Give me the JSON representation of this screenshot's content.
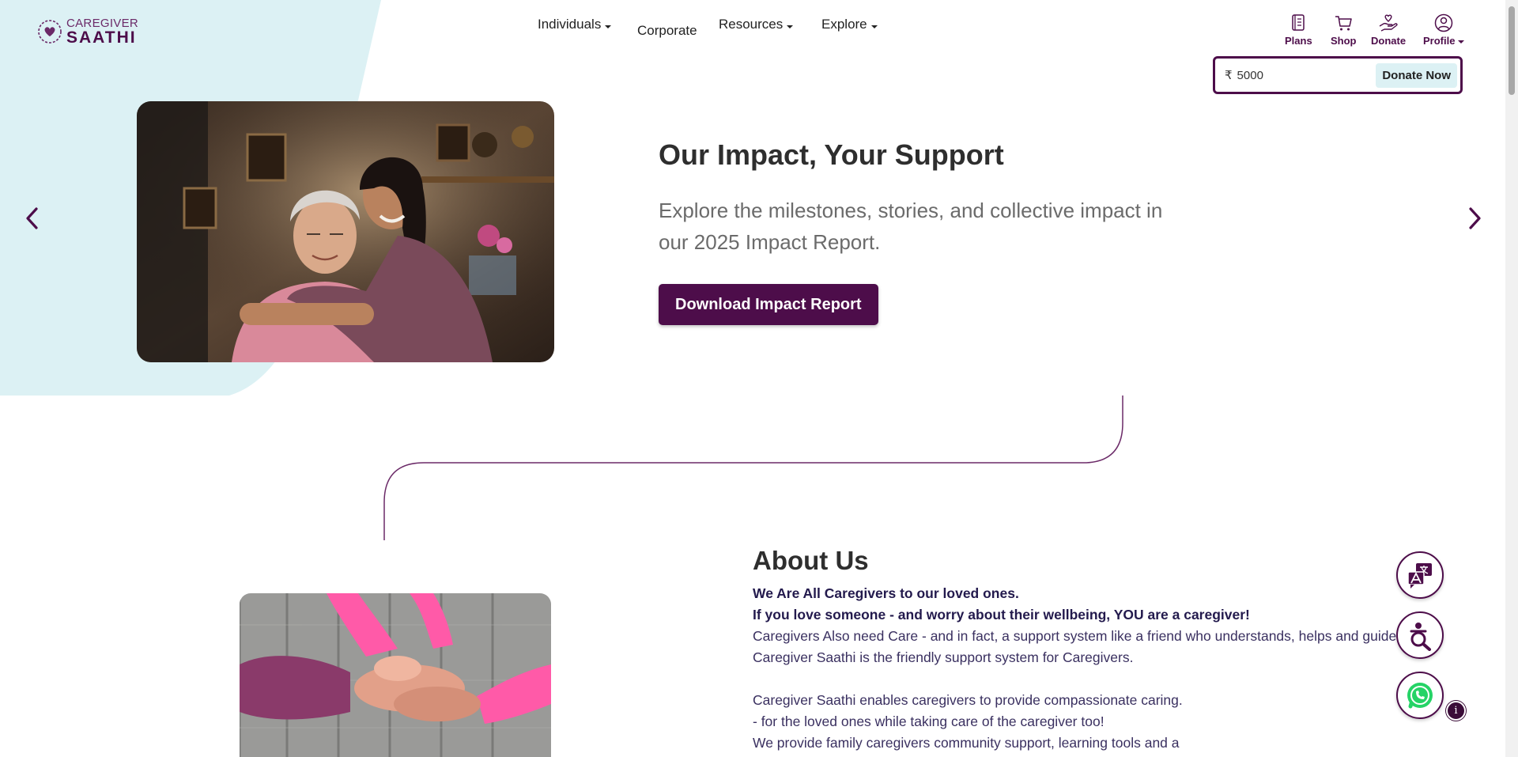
{
  "header": {
    "logo": {
      "line1": "CAREGIVER",
      "line2": "SAATHI"
    },
    "nav": [
      {
        "label": "Individuals",
        "dropdown": true
      },
      {
        "label": "Corporate",
        "dropdown": false
      },
      {
        "label": "Resources",
        "dropdown": true
      },
      {
        "label": "Explore",
        "dropdown": true
      }
    ],
    "icons": {
      "plans": "Plans",
      "shop": "Shop",
      "donate": "Donate",
      "profile": "Profile"
    },
    "donation": {
      "currency": "₹",
      "amount": "5000",
      "button": "Donate Now"
    }
  },
  "hero": {
    "title": "Our Impact, Your Support",
    "subtitle": "Explore the milestones, stories, and collective impact in our 2025 Impact Report.",
    "button": "Download Impact Report"
  },
  "about": {
    "title": "About Us",
    "lines": [
      "We Are All Caregivers to our loved ones.",
      "If you love someone - and worry about their wellbeing, YOU are a caregiver!",
      "Caregivers Also need Care - and in fact, a support system like a friend who understands, helps and guides.",
      "Caregiver Saathi is the friendly support system for Caregivers.",
      "Caregiver Saathi enables caregivers to provide compassionate caring.",
      "- for the loved ones while taking care of the caregiver too!",
      "We provide family caregivers community support, learning tools and a"
    ]
  },
  "floating": {
    "info": "i"
  },
  "colors": {
    "brand": "#4d0d4a",
    "accent_bg": "#dcf1f4"
  },
  "icon_names": [
    "plans-icon",
    "cart-icon",
    "donate-hand-icon",
    "profile-icon",
    "chevron-left-icon",
    "chevron-right-icon",
    "translate-icon",
    "accessibility-search-icon",
    "whatsapp-icon",
    "info-icon"
  ]
}
